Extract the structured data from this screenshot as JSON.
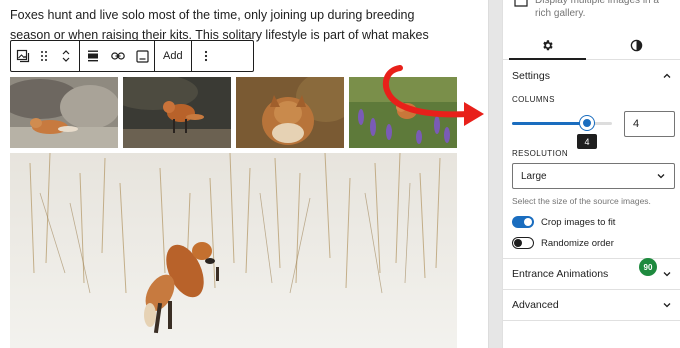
{
  "editor": {
    "paragraph": "Foxes hunt and live solo most of the time, only joining up during breeding season or when raising their kits. This solitary lifestyle is part of what makes them such mysterious",
    "toolbar": {
      "add_label": "Add"
    }
  },
  "sidebar": {
    "description": "Display multiple images in a rich gallery.",
    "tabs": [
      {
        "name": "settings-tab",
        "icon": "gear-icon",
        "active": true
      },
      {
        "name": "styles-tab",
        "icon": "half-circle-icon",
        "active": false
      }
    ],
    "settings_panel": {
      "title": "Settings",
      "columns_label": "COLUMNS",
      "columns_value": 4,
      "columns_min": 1,
      "columns_max": 5,
      "columns_tooltip": "4",
      "columns_input": "4",
      "resolution_label": "RESOLUTION",
      "resolution_value": "Large",
      "resolution_help": "Select the size of the source images.",
      "crop_label": "Crop images to fit",
      "crop_on": true,
      "randomize_label": "Randomize order",
      "randomize_on": false
    },
    "entrance_animations": "Entrance Animations",
    "advanced": "Advanced",
    "badge": "90"
  },
  "colors": {
    "accent": "#1a6dbf",
    "badge": "#1e8a3e",
    "annotation_arrow": "#e8201a"
  }
}
